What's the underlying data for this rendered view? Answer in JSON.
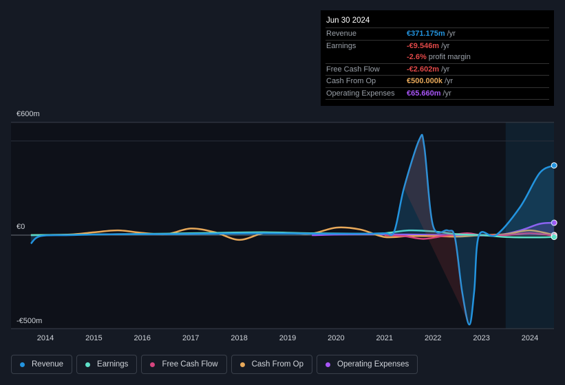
{
  "tooltip": {
    "date": "Jun 30 2024",
    "rows": [
      {
        "label": "Revenue",
        "value": "€371.175m",
        "unit": "/yr",
        "color": "#2394df"
      },
      {
        "label": "Earnings",
        "value": "-€9.546m",
        "unit": "/yr",
        "color": "#e04848"
      },
      {
        "label": "",
        "value": "-2.6%",
        "unit": "profit margin",
        "color": "#e04848"
      },
      {
        "label": "Free Cash Flow",
        "value": "-€2.602m",
        "unit": "/yr",
        "color": "#e04848"
      },
      {
        "label": "Cash From Op",
        "value": "€500.000k",
        "unit": "/yr",
        "color": "#e8a95a"
      },
      {
        "label": "Operating Expenses",
        "value": "€65.660m",
        "unit": "/yr",
        "color": "#a855f7"
      }
    ]
  },
  "chart_data": {
    "type": "line",
    "ylim": [
      -500,
      600
    ],
    "y_tick_labels": [
      "€600m",
      "€0",
      "-€500m"
    ],
    "y_ticks": [
      600,
      0,
      -500
    ],
    "x_ticks": [
      2014,
      2015,
      2016,
      2017,
      2018,
      2019,
      2020,
      2021,
      2022,
      2023,
      2024
    ],
    "x_tick_labels": [
      "2014",
      "2015",
      "2016",
      "2017",
      "2018",
      "2019",
      "2020",
      "2021",
      "2022",
      "2023",
      "2024"
    ],
    "xlim": [
      2013.5,
      2024.5
    ],
    "forecast_shade_from": 2023.5,
    "legend_placement": "bottom",
    "series": [
      {
        "name": "Revenue",
        "color": "#2394df",
        "fill": true,
        "points": [
          [
            2013.7,
            -45
          ],
          [
            2013.9,
            -5
          ],
          [
            2014.5,
            0
          ],
          [
            2015.5,
            5
          ],
          [
            2016.5,
            5
          ],
          [
            2017.5,
            8
          ],
          [
            2018.5,
            10
          ],
          [
            2019.5,
            8
          ],
          [
            2020.5,
            8
          ],
          [
            2021,
            10
          ],
          [
            2021.2,
            20
          ],
          [
            2021.4,
            250
          ],
          [
            2021.72,
            510
          ],
          [
            2021.82,
            470
          ],
          [
            2022,
            50
          ],
          [
            2022.3,
            25
          ],
          [
            2022.45,
            -10
          ],
          [
            2022.6,
            -300
          ],
          [
            2022.75,
            -476
          ],
          [
            2022.85,
            -300
          ],
          [
            2022.95,
            0
          ],
          [
            2023.3,
            0
          ],
          [
            2023.8,
            150
          ],
          [
            2024.2,
            330
          ],
          [
            2024.5,
            371
          ]
        ]
      },
      {
        "name": "Earnings",
        "color": "#5ee0c8",
        "fill": false,
        "points": [
          [
            2013.7,
            0
          ],
          [
            2014.5,
            2
          ],
          [
            2015.5,
            5
          ],
          [
            2016.5,
            8
          ],
          [
            2017.5,
            12
          ],
          [
            2018.5,
            15
          ],
          [
            2019.5,
            10
          ],
          [
            2020.5,
            8
          ],
          [
            2021,
            10
          ],
          [
            2021.5,
            25
          ],
          [
            2022,
            20
          ],
          [
            2022.5,
            5
          ],
          [
            2023,
            0
          ],
          [
            2023.5,
            -10
          ],
          [
            2024.2,
            -12
          ],
          [
            2024.5,
            -9.5
          ]
        ]
      },
      {
        "name": "Free Cash Flow",
        "color": "#d6457f",
        "fill": false,
        "points": [
          [
            2021,
            0
          ],
          [
            2021.4,
            -5
          ],
          [
            2021.8,
            -20
          ],
          [
            2022.2,
            -5
          ],
          [
            2022.7,
            10
          ],
          [
            2023,
            0
          ],
          [
            2023.5,
            0
          ],
          [
            2024,
            10
          ],
          [
            2024.5,
            -2.6
          ]
        ]
      },
      {
        "name": "Cash From Op",
        "color": "#e8a95a",
        "fill": false,
        "points": [
          [
            2013.7,
            0
          ],
          [
            2014.5,
            3
          ],
          [
            2015,
            15
          ],
          [
            2015.5,
            25
          ],
          [
            2016,
            12
          ],
          [
            2016.5,
            5
          ],
          [
            2017,
            35
          ],
          [
            2017.5,
            15
          ],
          [
            2018,
            -25
          ],
          [
            2018.5,
            10
          ],
          [
            2019,
            12
          ],
          [
            2019.5,
            8
          ],
          [
            2020,
            40
          ],
          [
            2020.5,
            30
          ],
          [
            2021,
            -10
          ],
          [
            2021.5,
            -5
          ],
          [
            2022,
            -5
          ],
          [
            2022.5,
            -8
          ],
          [
            2023,
            0
          ],
          [
            2023.5,
            5
          ],
          [
            2024,
            25
          ],
          [
            2024.5,
            0.5
          ]
        ]
      },
      {
        "name": "Operating Expenses",
        "color": "#a855f7",
        "fill": true,
        "points": [
          [
            2019.5,
            0
          ],
          [
            2020.5,
            5
          ],
          [
            2021.5,
            3
          ],
          [
            2022.5,
            0
          ],
          [
            2023.3,
            0
          ],
          [
            2023.8,
            25
          ],
          [
            2024.2,
            60
          ],
          [
            2024.5,
            65.7
          ]
        ]
      }
    ]
  },
  "legend": [
    "Revenue",
    "Earnings",
    "Free Cash Flow",
    "Cash From Op",
    "Operating Expenses"
  ]
}
